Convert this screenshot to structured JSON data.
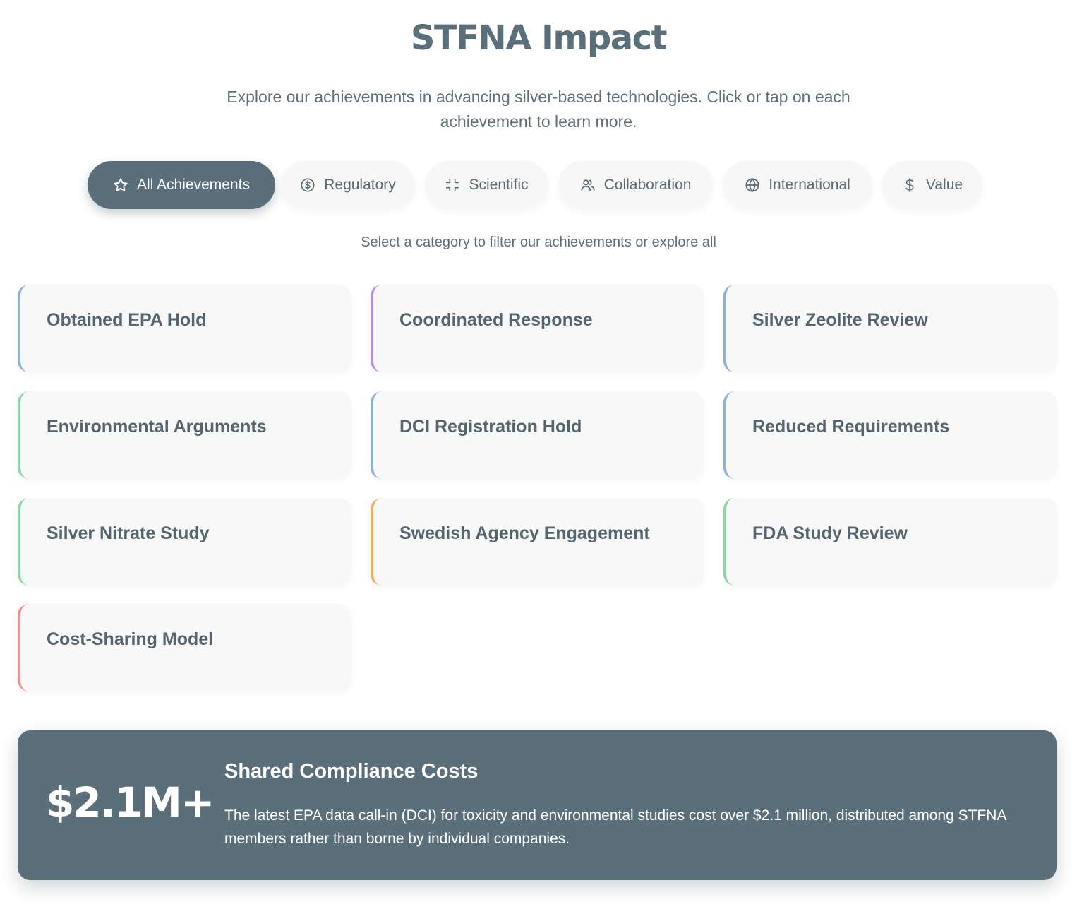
{
  "header": {
    "title": "STFNA Impact",
    "intro": "Explore our achievements in advancing silver-based technologies. Click or tap on each achievement to learn more."
  },
  "filters": {
    "tabs": [
      {
        "label": "All Achievements",
        "icon": "star-icon",
        "active": true
      },
      {
        "label": "Regulatory",
        "icon": "dollar-circle-icon",
        "active": false
      },
      {
        "label": "Scientific",
        "icon": "collapse-icon",
        "active": false
      },
      {
        "label": "Collaboration",
        "icon": "users-icon",
        "active": false
      },
      {
        "label": "International",
        "icon": "globe-icon",
        "active": false
      },
      {
        "label": "Value",
        "icon": "dollar-icon",
        "active": false
      }
    ],
    "hint": "Select a category to filter our achievements or explore all"
  },
  "achievements": [
    {
      "title": "Obtained EPA Hold",
      "accent": "#8eaee0"
    },
    {
      "title": "Coordinated Response",
      "accent": "#b48ee8"
    },
    {
      "title": "Silver Zeolite Review",
      "accent": "#8eaee0"
    },
    {
      "title": "Environmental Arguments",
      "accent": "#8fd3a8"
    },
    {
      "title": "DCI Registration Hold",
      "accent": "#8eaee0"
    },
    {
      "title": "Reduced Requirements",
      "accent": "#8eaee0"
    },
    {
      "title": "Silver Nitrate Study",
      "accent": "#8fd3a8"
    },
    {
      "title": "Swedish Agency Engagement",
      "accent": "#f3ae5f"
    },
    {
      "title": "FDA Study Review",
      "accent": "#8fd3a8"
    },
    {
      "title": "Cost-Sharing Model",
      "accent": "#ef8f8f"
    }
  ],
  "highlight": {
    "stat": "$2.1M+",
    "title": "Shared Compliance Costs",
    "text": "The latest EPA data call-in (DCI) for toxicity and environmental studies cost over $2.1 million, distributed among STFNA members rather than borne by individual companies."
  },
  "colors": {
    "primary": "#5b6f7b",
    "tab_background": "#f7f7f7",
    "card_background": "#f8f8f8"
  }
}
